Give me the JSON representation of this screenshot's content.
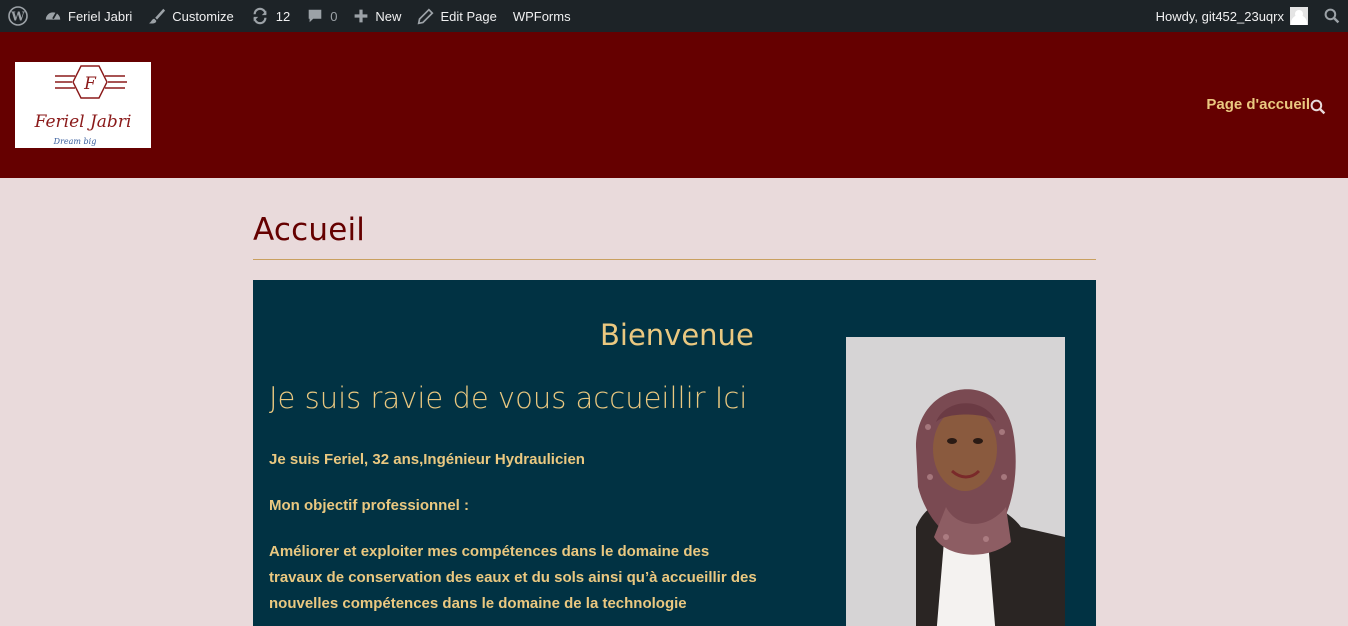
{
  "admin_bar": {
    "site_name": "Feriel Jabri",
    "customize": "Customize",
    "updates_count": "12",
    "comments_count": "0",
    "new_label": "New",
    "edit_page": "Edit Page",
    "wpforms": "WPForms",
    "howdy": "Howdy, git452_23uqrx",
    "icons": [
      "wordpress-icon",
      "dashboard-icon",
      "brush-icon",
      "updates-icon",
      "comment-icon",
      "plus-icon",
      "pencil-icon",
      "avatar",
      "search-icon"
    ]
  },
  "header": {
    "logo": {
      "name": "Feriel Jabri",
      "tagline": "Dream big",
      "initial": "F"
    },
    "nav": [
      {
        "label": "Page d'accueil",
        "current": true
      }
    ],
    "search_icon": "search-icon"
  },
  "page": {
    "title": "Accueil"
  },
  "hero": {
    "heading": "Bienvenue",
    "subheading": "Je suis ravie de vous accueillir Ici",
    "paragraphs": [
      "Je suis Feriel, 32 ans,Ingénieur Hydraulicien",
      "Mon objectif professionnel :",
      "Améliorer et exploiter mes compétences dans le domaine des travaux de conservation des eaux et du sols ainsi qu’à accueillir des nouvelles compétences dans le domaine de la technologie"
    ],
    "photo": "portrait-photo"
  },
  "colors": {
    "admin_bar": "#1d2327",
    "header": "#650000",
    "background": "#e9dadb",
    "hero": "#013243",
    "accent": "#eac880"
  }
}
